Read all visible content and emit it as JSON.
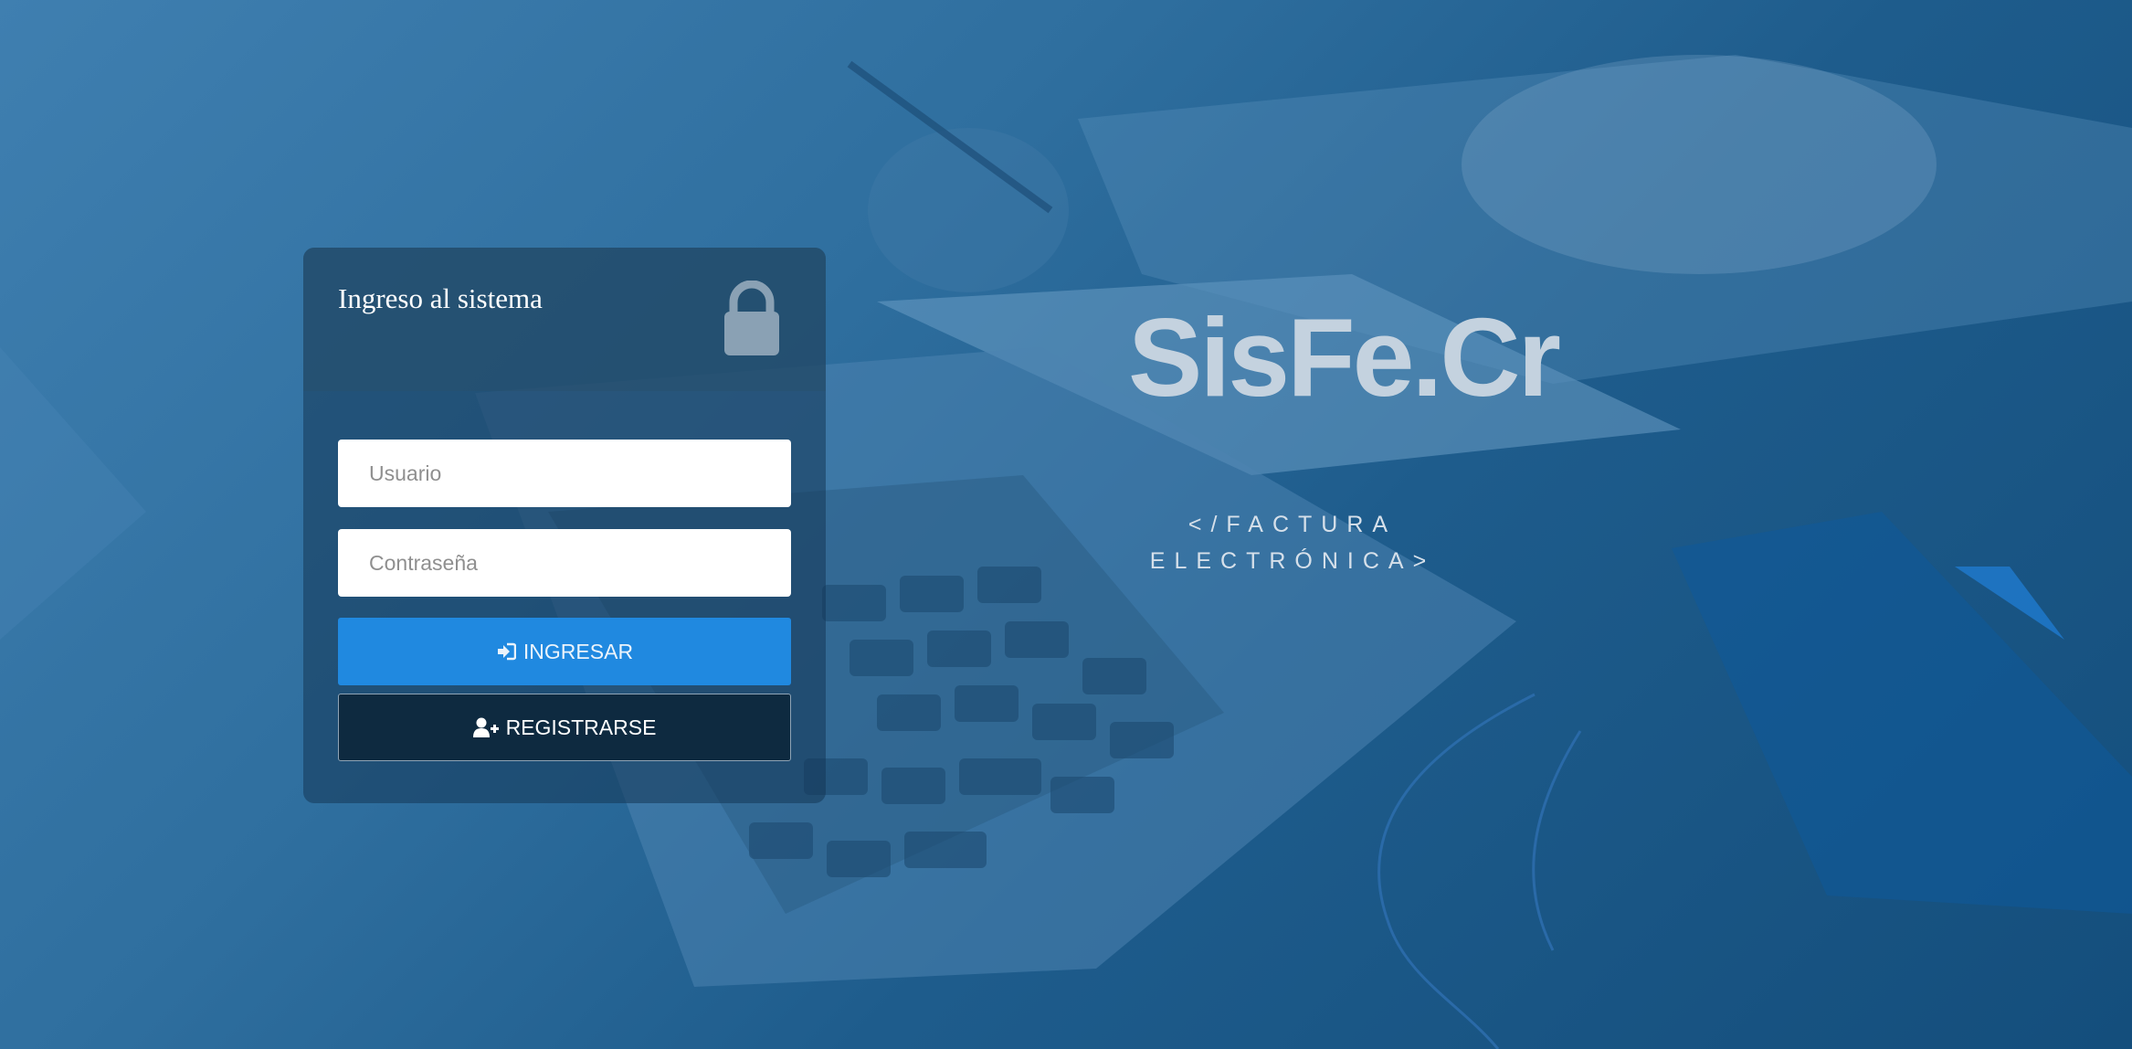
{
  "login": {
    "title": "Ingreso al sistema",
    "username_placeholder": "Usuario",
    "password_placeholder": "Contraseña",
    "login_label": "INGRESAR",
    "register_label": "REGISTRARSE",
    "icons": {
      "header": "lock-icon",
      "login": "sign-in-icon",
      "register": "user-plus-icon"
    }
  },
  "brand": {
    "name": "SisFe.Cr",
    "tagline_line1": "</FACTURA",
    "tagline_line2": "ELECTRÓNICA>"
  },
  "colors": {
    "accent": "#2089e0",
    "register_bg": "#0e2a40",
    "background": "#1e5c8c"
  }
}
